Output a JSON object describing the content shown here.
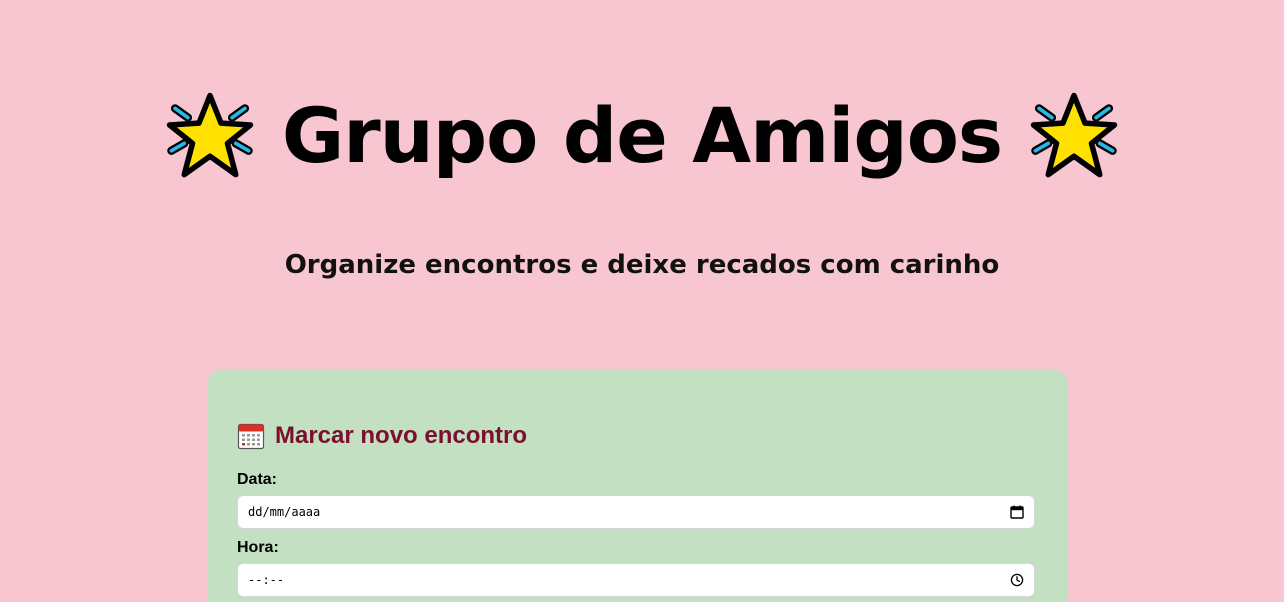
{
  "header": {
    "title": "Grupo de Amigos",
    "left_icon": "glowing-star-icon",
    "right_icon": "glowing-star-icon",
    "subtitle": "Organize encontros e deixe recados com carinho"
  },
  "meeting_form": {
    "icon": "calendar-icon",
    "title": "Marcar novo encontro",
    "date_label": "Data:",
    "date_placeholder": "dd/mm/aaaa",
    "date_icon": "calendar-picker-icon",
    "time_label": "Hora:",
    "time_placeholder": "--:--",
    "time_icon": "clock-icon"
  },
  "colors": {
    "page_background": "#f8c6d0",
    "card_background": "#c3e0c2",
    "card_title": "#7a0f2e"
  }
}
